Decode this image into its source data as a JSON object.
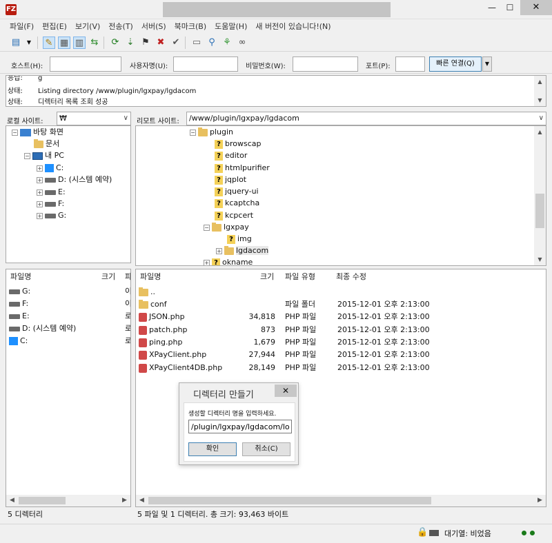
{
  "app": {
    "icon_label": "FZ"
  },
  "window": {
    "minimize": "—",
    "maximize": "☐",
    "close": "✕"
  },
  "menu": [
    "파일(F)",
    "편집(E)",
    "보기(V)",
    "전송(T)",
    "서버(S)",
    "북마크(B)",
    "도움말(H)",
    "새 버전이 있습니다!(N)"
  ],
  "toolbar": {
    "icons": [
      "site-manager-icon",
      "dropdown-arrow-icon",
      "message-log-icon",
      "local-tree-icon",
      "remote-tree-icon",
      "queue-icon",
      "refresh-icon",
      "process-queue-icon",
      "cancel-icon",
      "disconnect-icon",
      "reconnect-icon",
      "directory-compare-icon",
      "sync-browse-icon",
      "search-remote-icon",
      "find-icon"
    ]
  },
  "quickconnect": {
    "host_label": "호스트(H):",
    "user_label": "사용자명(U):",
    "pass_label": "비밀번호(W):",
    "port_label": "포트(P):",
    "button": "빠른 연결(Q)",
    "dropdown": "▼"
  },
  "log": [
    {
      "key": "응답:",
      "msg": "g"
    },
    {
      "key": "상태:",
      "msg": "Listing directory /www/plugin/lgxpay/lgdacom"
    },
    {
      "key": "상태:",
      "msg": "디렉터리 목록 조회 성공"
    }
  ],
  "local": {
    "site_label": "로컬 사이트:",
    "site_path": "₩",
    "tree": [
      {
        "label": "바탕 화면",
        "icon": "desktop-icon",
        "exp": "−"
      },
      {
        "label": "문서",
        "icon": "folder-icon",
        "exp": ""
      },
      {
        "label": "내 PC",
        "icon": "computer-icon",
        "exp": "−"
      },
      {
        "label": "C:",
        "icon": "windows-drive-icon",
        "exp": "+"
      },
      {
        "label": "D: (시스템 예약)",
        "icon": "drive-icon",
        "exp": "+"
      },
      {
        "label": "E:",
        "icon": "drive-icon",
        "exp": "+"
      },
      {
        "label": "F:",
        "icon": "drive-icon",
        "exp": "+"
      },
      {
        "label": "G:",
        "icon": "drive-icon",
        "exp": "+"
      }
    ],
    "columns": {
      "name": "파일명",
      "size": "크기",
      "type": "파"
    },
    "files": [
      {
        "name": "G:",
        "icon": "drive-icon",
        "type": "이"
      },
      {
        "name": "F:",
        "icon": "drive-icon",
        "type": "이"
      },
      {
        "name": "E:",
        "icon": "drive-icon",
        "type": "로"
      },
      {
        "name": "D: (시스템 예약)",
        "icon": "drive-icon",
        "type": "로"
      },
      {
        "name": "C:",
        "icon": "windows-drive-icon",
        "type": "로"
      }
    ],
    "status": "5 디렉터리"
  },
  "remote": {
    "site_label": "리모트 사이트:",
    "site_path": "/www/plugin/lgxpay/lgdacom",
    "tree": [
      {
        "label": "plugin",
        "icon": "folder-icon",
        "exp": "−"
      },
      {
        "label": "browscap",
        "icon": "unknown-folder-icon",
        "exp": ""
      },
      {
        "label": "editor",
        "icon": "unknown-folder-icon",
        "exp": ""
      },
      {
        "label": "htmlpurifier",
        "icon": "unknown-folder-icon",
        "exp": ""
      },
      {
        "label": "jqplot",
        "icon": "unknown-folder-icon",
        "exp": ""
      },
      {
        "label": "jquery-ui",
        "icon": "unknown-folder-icon",
        "exp": ""
      },
      {
        "label": "kcaptcha",
        "icon": "unknown-folder-icon",
        "exp": ""
      },
      {
        "label": "kcpcert",
        "icon": "unknown-folder-icon",
        "exp": ""
      },
      {
        "label": "lgxpay",
        "icon": "folder-icon",
        "exp": "−"
      },
      {
        "label": "img",
        "icon": "unknown-folder-icon",
        "exp": ""
      },
      {
        "label": "lgdacom",
        "icon": "folder-icon",
        "exp": "+"
      },
      {
        "label": "okname",
        "icon": "unknown-folder-icon",
        "exp": "+"
      }
    ],
    "columns": {
      "name": "파일명",
      "size": "크기",
      "type": "파일 유형",
      "modified": "최종 수정"
    },
    "files": [
      {
        "name": "..",
        "icon": "folder-icon",
        "size": "",
        "type": "",
        "modified": ""
      },
      {
        "name": "conf",
        "icon": "folder-icon",
        "size": "",
        "type": "파일 폴더",
        "modified": "2015-12-01 오후 2:13:00"
      },
      {
        "name": "JSON.php",
        "icon": "php-file-icon",
        "size": "34,818",
        "type": "PHP 파일",
        "modified": "2015-12-01 오후 2:13:00"
      },
      {
        "name": "patch.php",
        "icon": "php-file-icon",
        "size": "873",
        "type": "PHP 파일",
        "modified": "2015-12-01 오후 2:13:00"
      },
      {
        "name": "ping.php",
        "icon": "php-file-icon",
        "size": "1,679",
        "type": "PHP 파일",
        "modified": "2015-12-01 오후 2:13:00"
      },
      {
        "name": "XPayClient.php",
        "icon": "php-file-icon",
        "size": "27,944",
        "type": "PHP 파일",
        "modified": "2015-12-01 오후 2:13:00"
      },
      {
        "name": "XPayClient4DB.php",
        "icon": "php-file-icon",
        "size": "28,149",
        "type": "PHP 파일",
        "modified": "2015-12-01 오후 2:13:00"
      }
    ],
    "status": "5 파일 및 1 디렉터리. 총 크기: 93,463 바이트"
  },
  "dialog": {
    "title": "디렉터리 만들기",
    "close": "✕",
    "prompt": "생성할 디렉터리 명을 입력하세요.",
    "input_value": "/plugin/lgxpay/lgdacom/log",
    "ok": "확인",
    "cancel": "취소(C)"
  },
  "statusbar": {
    "queue": "대기열: 비었음"
  }
}
